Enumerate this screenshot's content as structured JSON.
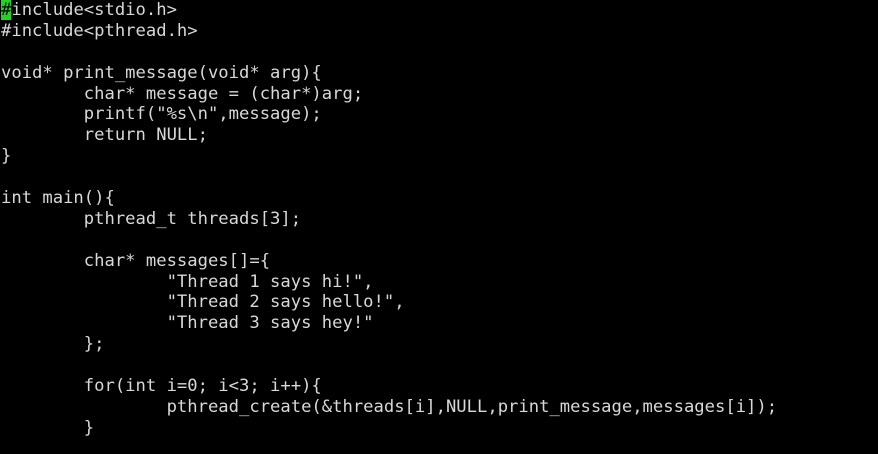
{
  "editor": {
    "cursor_char": "#",
    "colors": {
      "background": "#000000",
      "foreground": "#d8d8d8",
      "cursor": "#22d422"
    },
    "lines": [
      "include<stdio.h>",
      "#include<pthread.h>",
      "",
      "void* print_message(void* arg){",
      "        char* message = (char*)arg;",
      "        printf(\"%s\\n\",message);",
      "        return NULL;",
      "}",
      "",
      "int main(){",
      "        pthread_t threads[3];",
      "",
      "        char* messages[]={",
      "                \"Thread 1 says hi!\",",
      "                \"Thread 2 says hello!\",",
      "                \"Thread 3 says hey!\"",
      "        };",
      "",
      "        for(int i=0; i<3; i++){",
      "                pthread_create(&threads[i],NULL,print_message,messages[i]);",
      "        }"
    ]
  }
}
